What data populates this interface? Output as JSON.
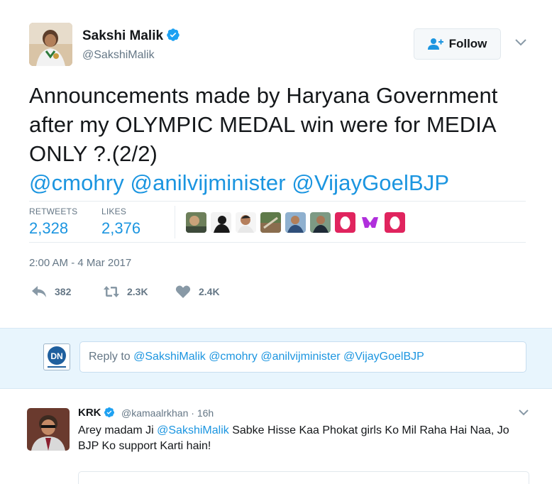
{
  "tweet": {
    "author_name": "Sakshi Malik",
    "author_handle": "@SakshiMalik",
    "follow_label": "Follow",
    "text_plain": "Announcements made by Haryana Government after my OLYMPIC MEDAL win were for MEDIA ONLY ?.(2/2)",
    "mentions": [
      "@cmohry",
      "@anilvijminister",
      "@VijayGoelBJP"
    ],
    "retweets_label": "RETWEETS",
    "retweets_value": "2,328",
    "likes_label": "LIKES",
    "likes_value": "2,376",
    "timestamp": "2:00 AM - 4 Mar 2017",
    "reply_count": "382",
    "retweet_count": "2.3K",
    "like_count": "2.4K"
  },
  "reply_compose": {
    "prefix": "Reply to ",
    "mentions": "@SakshiMalik @cmohry @anilvijminister @VijayGoelBJP",
    "avatar_text": "DN"
  },
  "reply_tweet": {
    "author_name": "KRK",
    "author_handle": "@kamaalrkhan",
    "time": "· 16h",
    "text_before": "Arey madam Ji ",
    "mention": "@SakshiMalik",
    "text_after": " Sabke Hisse Kaa Phokat girls Ko Mil Raha Hai Naa, Jo BJP Ko support Karti hain!"
  },
  "colors": {
    "accent_blue": "#1b95e0",
    "muted_gray": "#657786",
    "text_dark": "#14171a",
    "reply_bg": "#e8f5fd",
    "like_pink": "#e0245e"
  },
  "icons": [
    "verified-badge-icon",
    "follow-person-icon",
    "chevron-down-icon",
    "reply-icon",
    "retweet-icon",
    "heart-icon"
  ]
}
